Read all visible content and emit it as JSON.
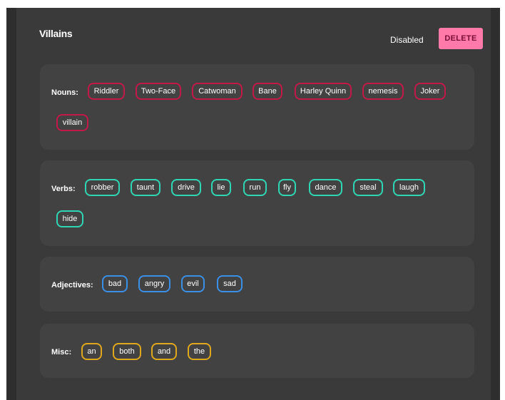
{
  "header": {
    "title": "Villains",
    "status": "Disabled",
    "delete_label": "DELETE"
  },
  "categories": {
    "nouns": {
      "label": "Nouns:",
      "color": "#c2184a",
      "words": [
        "Riddler",
        "Two-Face",
        "Catwoman",
        "Bane",
        "Harley Quinn",
        "nemesis",
        "Joker",
        "villain"
      ]
    },
    "verbs": {
      "label": "Verbs:",
      "color": "#2fd6b3",
      "words": [
        "robber",
        "taunt",
        "drive",
        "lie",
        "run",
        "fly",
        "dance",
        "steal",
        "laugh",
        "hide"
      ]
    },
    "adjectives": {
      "label": "Adjectives:",
      "color": "#3a8fe6",
      "words": [
        "bad",
        "angry",
        "evil",
        "sad"
      ]
    },
    "misc": {
      "label": "Misc:",
      "color": "#e0a81c",
      "words": [
        "an",
        "both",
        "and",
        "the"
      ]
    }
  },
  "colors": {
    "background": "#3a3a3a",
    "card": "#424242",
    "delete_button": "#ff7aa8"
  }
}
